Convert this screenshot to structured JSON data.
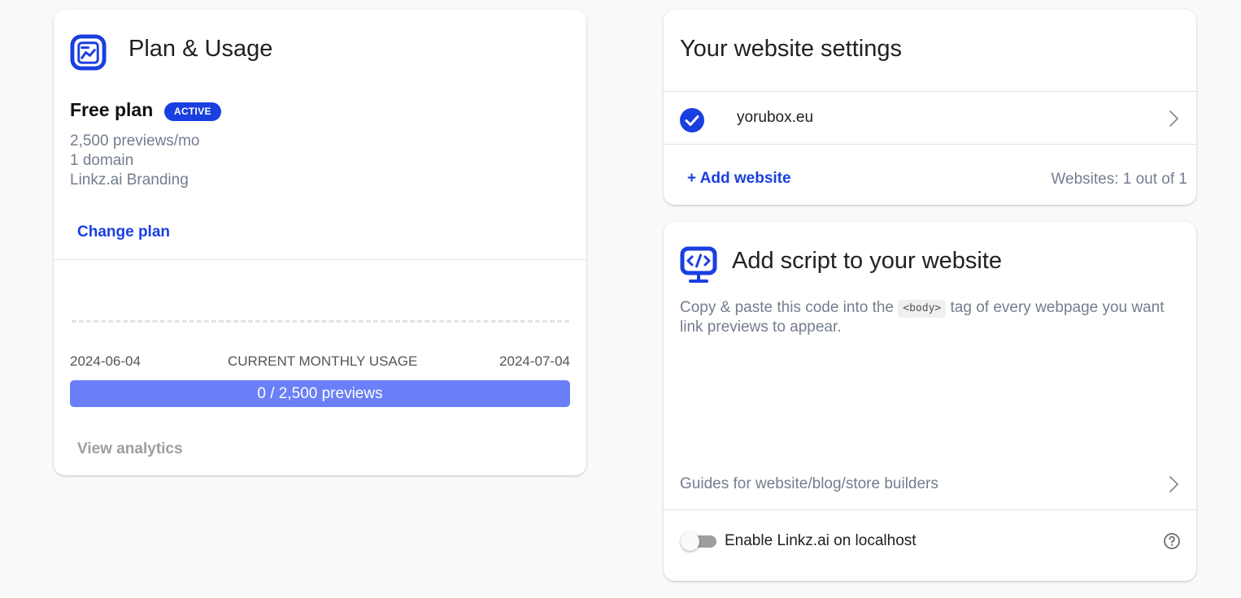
{
  "colors": {
    "accent": "#1a3fe0",
    "progress_bar": "#6b7ff8",
    "muted_text": "#747d8f",
    "disabled_text": "#9e9e9e"
  },
  "plan_usage": {
    "icon": "analytics-board-icon",
    "title": "Plan & Usage",
    "plan_name": "Free plan",
    "status_badge": "ACTIVE",
    "features": [
      "2,500 previews/mo",
      "1 domain",
      "Linkz.ai Branding"
    ],
    "change_plan_label": "Change plan",
    "period_start": "2024-06-04",
    "usage_caption": "CURRENT MONTHLY USAGE",
    "period_end": "2024-07-04",
    "usage_text": "0 / 2,500 previews",
    "usage_fraction": 0,
    "view_analytics_label": "View analytics"
  },
  "website_settings": {
    "title": "Your website settings",
    "websites": [
      {
        "domain": "yorubox.eu",
        "status_icon": "check-circle-icon"
      }
    ],
    "add_website_label": "+ Add website",
    "websites_count": "Websites: 1 out of 1"
  },
  "add_script": {
    "icon": "code-monitor-icon",
    "title": "Add script to your website",
    "instruction_before": "Copy & paste this code into the ",
    "instruction_code": "<body>",
    "instruction_after": " tag of every webpage you want link previews to appear.",
    "guides_label": "Guides for website/blog/store builders",
    "localhost_toggle_label": "Enable Linkz.ai on localhost",
    "localhost_enabled": false,
    "help_icon": "question-circle-icon"
  }
}
